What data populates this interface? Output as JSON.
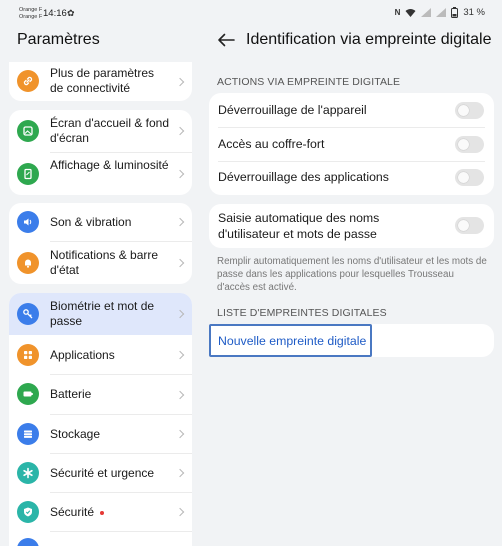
{
  "status_bar": {
    "carrier_1": "Orange F",
    "carrier_2": "Orange F",
    "time": "14:16",
    "battery": "31 %",
    "icons": [
      "gear-icon",
      "nfc-icon",
      "wifi-icon",
      "signal-icon",
      "battery-icon"
    ]
  },
  "left": {
    "title": "Paramètres",
    "items": [
      {
        "label": "Plus de paramètres de connectivité",
        "icon": "link-icon",
        "color": "#f0932b"
      },
      {
        "label": "Écran d'accueil & fond d'écran",
        "icon": "home-screen-icon",
        "color": "#2ea84f"
      },
      {
        "label": "Affichage & luminosité",
        "icon": "display-icon",
        "color": "#2ea84f"
      },
      {
        "label": "Son & vibration",
        "icon": "sound-icon",
        "color": "#3b7dea"
      },
      {
        "label": "Notifications & barre d'état",
        "icon": "bell-icon",
        "color": "#f0932b"
      },
      {
        "label": "Biométrie et mot de passe",
        "icon": "key-icon",
        "color": "#3b7dea",
        "selected": true
      },
      {
        "label": "Applications",
        "icon": "apps-icon",
        "color": "#f0932b"
      },
      {
        "label": "Batterie",
        "icon": "battery-icon",
        "color": "#2ea84f"
      },
      {
        "label": "Stockage",
        "icon": "storage-icon",
        "color": "#3b7dea"
      },
      {
        "label": "Sécurité et urgence",
        "icon": "asterisk-icon",
        "color": "#2bb5a8"
      },
      {
        "label": "Sécurité",
        "icon": "shield-icon",
        "color": "#2bb5a8",
        "badge": true
      }
    ]
  },
  "right": {
    "title": "Identification via empreinte digitale",
    "section1": "ACTIONS VIA EMPREINTE DIGITALE",
    "toggles": [
      {
        "label": "Déverrouillage de l'appareil",
        "on": false
      },
      {
        "label": "Accès au coffre-fort",
        "on": false
      },
      {
        "label": "Déverrouillage des applications",
        "on": false
      }
    ],
    "autofill": {
      "label": "Saisie automatique des noms d'utilisateur et mots de passe",
      "on": false
    },
    "note": "Remplir automatiquement les noms d'utilisateur et les mots de passe dans les applications pour lesquelles Trousseau d'accès est activé.",
    "section2": "LISTE D'EMPREINTES DIGITALES",
    "new_fingerprint": "Nouvelle empreinte digitale"
  }
}
